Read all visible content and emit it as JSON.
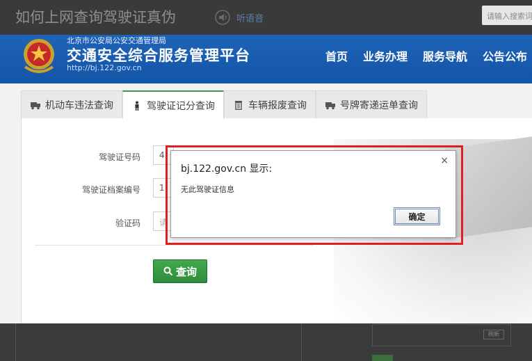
{
  "topbar": {
    "title": "如何上网查询驾驶证真伪",
    "listen_label": "听语音",
    "search_placeholder": "请输入搜索词"
  },
  "header": {
    "org_name": "北京市公安局公安交通管理局",
    "platform_name": "交通安全综合服务管理平台",
    "url": "http://bj.122.gov.cn",
    "nav": [
      "首页",
      "业务办理",
      "服务导航",
      "公告公布"
    ]
  },
  "tabs": [
    {
      "label": "机动车违法查询",
      "icon": "truck-icon",
      "active": false
    },
    {
      "label": "驾驶证记分查询",
      "icon": "person-icon",
      "active": true
    },
    {
      "label": "车辆报废查询",
      "icon": "trash-icon",
      "active": false
    },
    {
      "label": "号牌寄递运单查询",
      "icon": "truck-icon",
      "active": false
    }
  ],
  "form": {
    "license_number_label": "驾驶证号码",
    "license_number_value": "4",
    "file_number_label": "驾驶证档案编号",
    "file_number_value": "1",
    "captcha_label": "验证码",
    "captcha_placeholder": "请",
    "query_button": "查询"
  },
  "bottom": {
    "small_button": "刷新"
  },
  "dialog": {
    "title": "bj.122.gov.cn 显示:",
    "close": "×",
    "message": "无此驾驶证信息",
    "ok_label": "确定"
  },
  "colors": {
    "header_blue": "#1a5cb0",
    "accent_green": "#3c9a4a",
    "highlight_red": "#e02020"
  }
}
